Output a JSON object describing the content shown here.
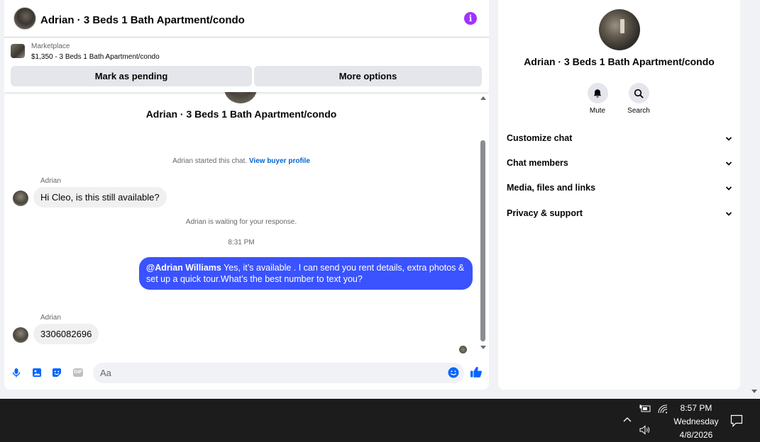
{
  "header": {
    "title": "Adrian · 3 Beds 1 Bath Apartment/condo"
  },
  "listing": {
    "label": "Marketplace",
    "price_title": "$1,350 - 3 Beds 1 Bath Apartment/condo",
    "pending_button": "Mark as pending",
    "more_button": "More options"
  },
  "conversation": {
    "title": "Adrian · 3 Beds 1 Bath Apartment/condo",
    "started_text": "Adrian started this chat.",
    "buyer_profile_link": "View buyer profile",
    "messages": [
      {
        "sender": "Adrian",
        "text": "Hi Cleo, is this still available?"
      },
      {
        "mention": "@Adrian Williams",
        "text": "Yes, it’s available .  I can send you rent details, extra photos & set up a quick tour.What’s the best number to text you?"
      },
      {
        "sender": "Adrian",
        "text": "3306082696"
      }
    ],
    "waiting_text": "Adrian is waiting for your response.",
    "timestamp": "8:31 PM"
  },
  "composer": {
    "placeholder": "Aa"
  },
  "info_panel": {
    "title": "Adrian · 3 Beds 1 Bath Apartment/condo",
    "actions": [
      {
        "label": "Mute"
      },
      {
        "label": "Search"
      }
    ],
    "sections": [
      {
        "label": "Customize chat"
      },
      {
        "label": "Chat members"
      },
      {
        "label": "Media, files and links"
      },
      {
        "label": "Privacy & support"
      }
    ]
  },
  "taskbar": {
    "time": "8:57 PM",
    "day": "Wednesday",
    "date": "4/8/2026"
  },
  "colors": {
    "accent": "#3a53ff",
    "info_icon": "#a033ff",
    "link": "#0064d1",
    "icon_blue": "#0866ff"
  },
  "icons": [
    "info-icon",
    "mic-icon",
    "photo-icon",
    "sticker-icon",
    "gif-icon",
    "emoji-icon",
    "like-icon",
    "bell-icon",
    "search-icon",
    "chevron-down-icon",
    "battery-icon",
    "wifi-icon",
    "volume-icon",
    "notification-icon"
  ]
}
